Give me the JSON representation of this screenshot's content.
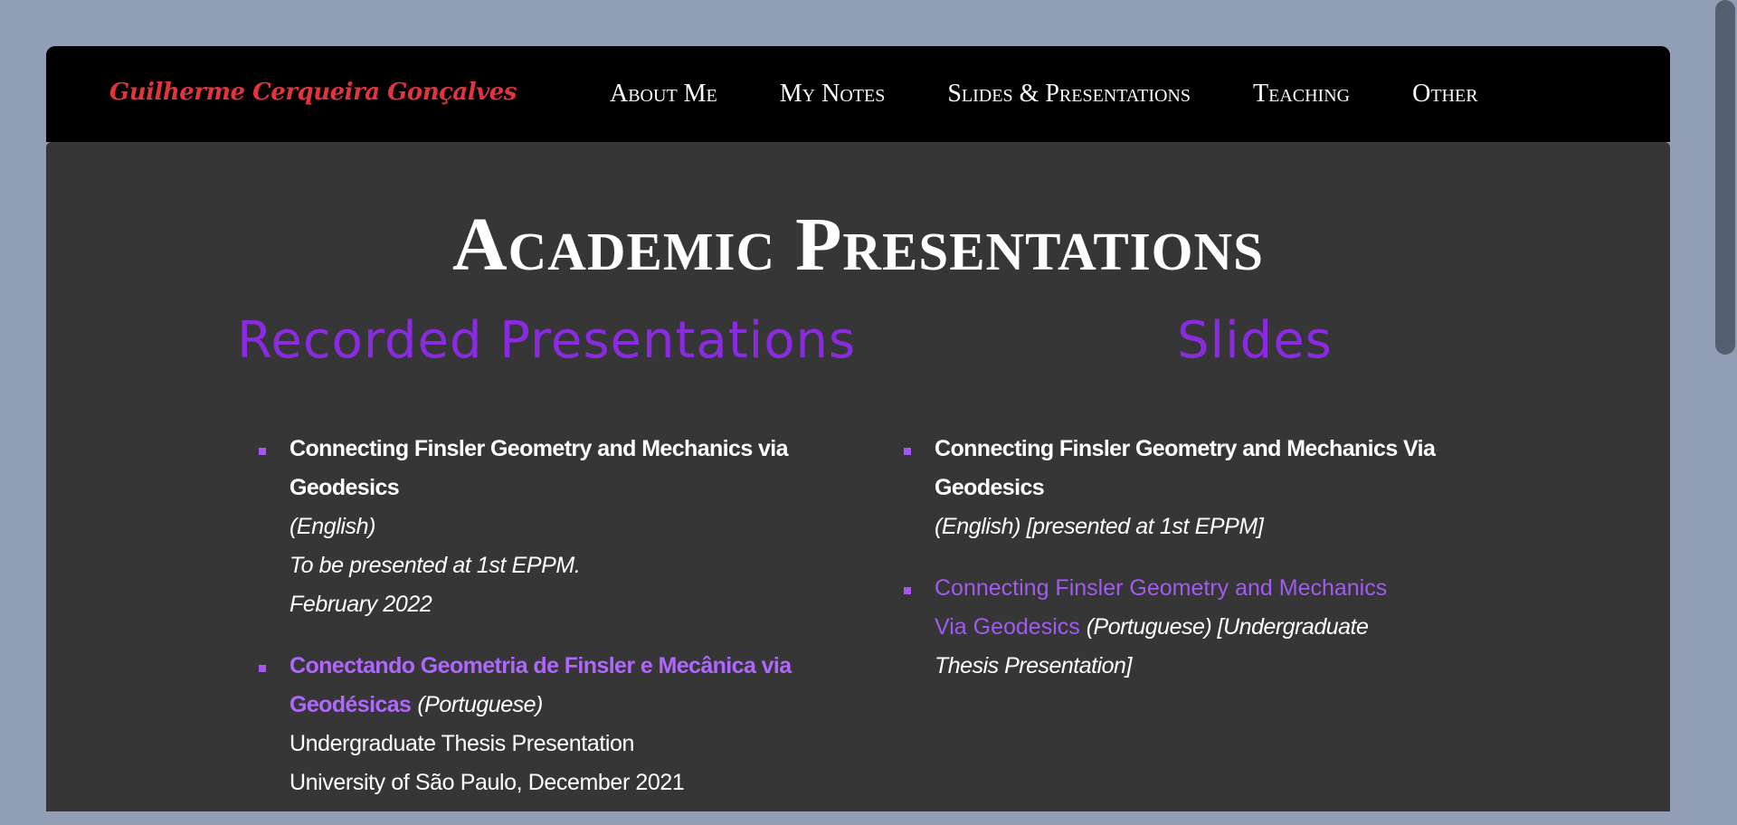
{
  "header": {
    "brand": "Guilherme Cerqueira Gonçalves",
    "nav": [
      {
        "label": "About Me"
      },
      {
        "label": "My Notes"
      },
      {
        "label": "Slides & Presentations"
      },
      {
        "label": "Teaching"
      },
      {
        "label": "Other"
      }
    ]
  },
  "main": {
    "title": "Academic Presentations",
    "recorded": {
      "heading": "Recorded Presentations",
      "items": [
        {
          "title": "Connecting Finsler Geometry and Mechanics via Geodesics",
          "language": "(English)",
          "line1": "To be presented at 1st EPPM.",
          "line2": "February 2022"
        },
        {
          "title": "Conectando Geometria de Finsler e Mecânica via Geodésicas",
          "language": "(Portuguese)",
          "line1": "Undergraduate Thesis Presentation",
          "line2": "University of São Paulo, December 2021"
        }
      ]
    },
    "slides": {
      "heading": "Slides",
      "items": [
        {
          "title": "Connecting Finsler Geometry and Mechanics Via Geodesics",
          "note": "(English) [presented at 1st EPPM]"
        },
        {
          "title": "Connecting Finsler Geometry and Mechanics Via Geodesics",
          "note": "(Portuguese) [Undergraduate Thesis Presentation]"
        }
      ]
    }
  },
  "colors": {
    "background": "#919eb6",
    "navbar": "#000000",
    "brand": "#e0343f",
    "content": "#363636",
    "heading": "#8a2be2",
    "link": "#a05bf0"
  }
}
